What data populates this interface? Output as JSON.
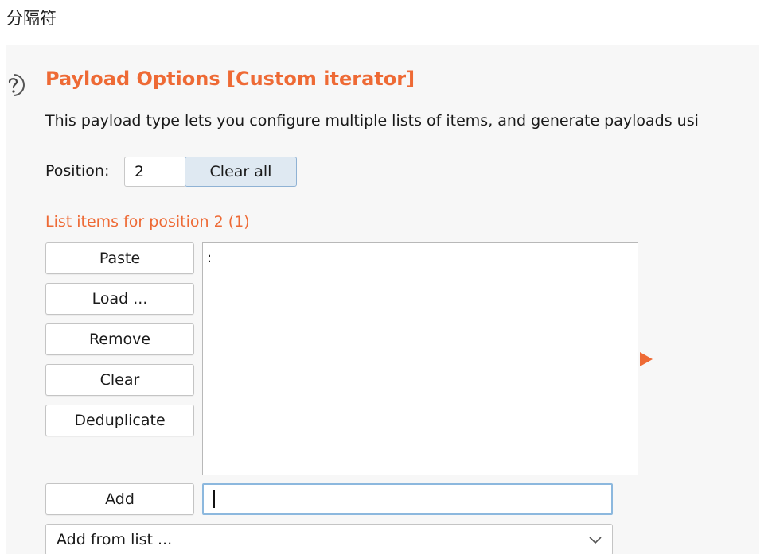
{
  "caption": "分隔符",
  "panel": {
    "title": "Payload Options [Custom iterator]",
    "description": "This payload type lets you configure multiple lists of items, and generate payloads usi",
    "position": {
      "label": "Position:",
      "value": "2",
      "clear_all_label": "Clear all"
    },
    "list_heading": "List items for position 2 (1)",
    "buttons": {
      "paste": "Paste",
      "load": "Load ...",
      "remove": "Remove",
      "clear": "Clear",
      "deduplicate": "Deduplicate",
      "add": "Add"
    },
    "list_items": [
      ":"
    ],
    "add_input_value": "",
    "add_from_list": "Add from list ...",
    "colors": {
      "accent": "#ee6a35",
      "focus_border": "#8cb8de"
    },
    "icons": {
      "help": "help-question-icon",
      "expand": "triangle-right-icon",
      "dropdown": "chevron-down-icon"
    }
  }
}
